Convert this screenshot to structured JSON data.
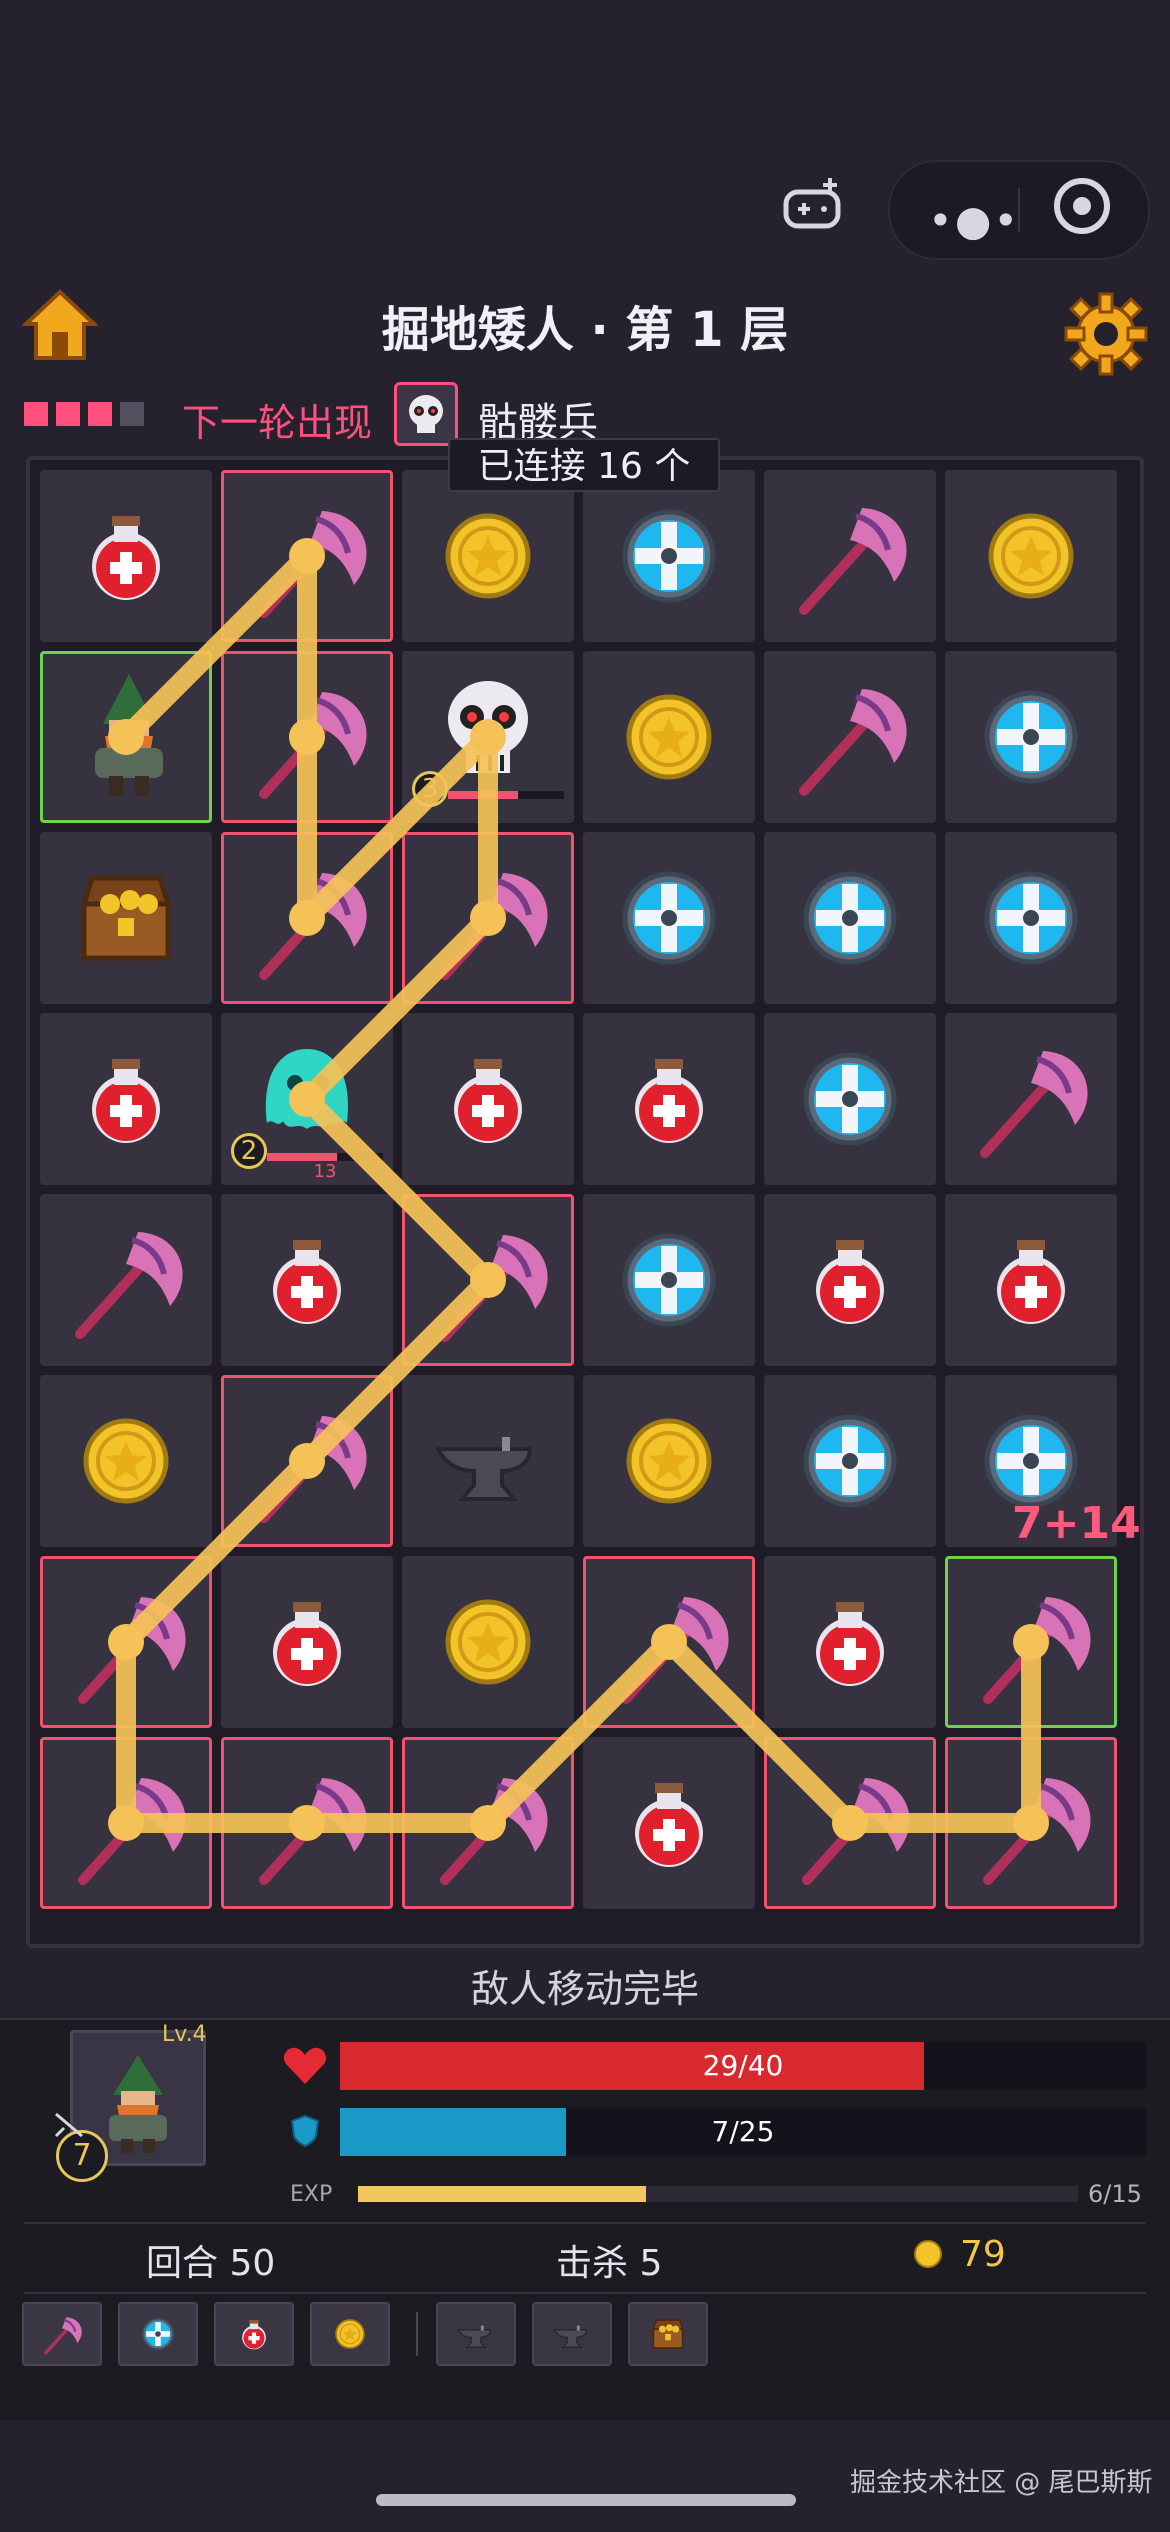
{
  "app": {
    "title": "掘地矮人 · 第 1 层"
  },
  "next_turn": {
    "label": "下一轮出现",
    "enemy_name": "骷髅兵",
    "chain_text": "已连接 16 个",
    "turn_dots": [
      "#ff4f7d",
      "#ff4f7d",
      "#ff4f7d",
      "#555060"
    ]
  },
  "board": {
    "rows": [
      [
        "potion",
        "axe",
        "coin",
        "shield",
        "axe",
        "coin"
      ],
      [
        "hero",
        "axe",
        "skeleton",
        "coin",
        "axe",
        "shield"
      ],
      [
        "chest",
        "axe",
        "axe",
        "shield",
        "shield",
        "shield"
      ],
      [
        "potion",
        "slime",
        "potion",
        "potion",
        "shield",
        "axe"
      ],
      [
        "axe",
        "potion",
        "axe",
        "shield",
        "potion",
        "potion"
      ],
      [
        "coin",
        "axe",
        "anvil",
        "coin",
        "shield",
        "shield"
      ],
      [
        "axe",
        "potion",
        "coin",
        "axe",
        "potion",
        "axe"
      ],
      [
        "axe",
        "axe",
        "axe",
        "potion",
        "axe",
        "axe"
      ]
    ],
    "selected": [
      [
        0,
        1
      ],
      [
        1,
        1
      ],
      [
        2,
        1
      ],
      [
        2,
        2
      ],
      [
        4,
        2
      ],
      [
        5,
        1
      ],
      [
        6,
        0
      ],
      [
        7,
        0
      ],
      [
        7,
        1
      ],
      [
        7,
        2
      ],
      [
        6,
        3
      ],
      [
        7,
        4
      ],
      [
        7,
        5
      ],
      [
        6,
        5
      ]
    ],
    "hero_cells": [
      [
        1,
        0
      ],
      [
        6,
        5
      ]
    ],
    "enemies": [
      {
        "row": 1,
        "col": 2,
        "attack": "3",
        "hp_label": ""
      },
      {
        "row": 3,
        "col": 1,
        "attack": "2",
        "hp_label": "13"
      }
    ],
    "damage_popup": "7+14",
    "path": [
      [
        1,
        0
      ],
      [
        0,
        1
      ],
      [
        1,
        1
      ],
      [
        2,
        1
      ],
      [
        1,
        2
      ],
      [
        2,
        2
      ],
      [
        3,
        1
      ],
      [
        4,
        2
      ],
      [
        5,
        1
      ],
      [
        6,
        0
      ],
      [
        7,
        0
      ],
      [
        7,
        1
      ],
      [
        7,
        2
      ],
      [
        6,
        3
      ],
      [
        7,
        4
      ],
      [
        7,
        5
      ],
      [
        6,
        5
      ]
    ]
  },
  "status": {
    "message": "敌人移动完毕"
  },
  "player": {
    "level": "Lv.4",
    "attack": "7",
    "hp": {
      "current": 29,
      "max": 40,
      "text": "29/40"
    },
    "armor": {
      "current": 7,
      "max": 25,
      "text": "7/25"
    },
    "exp": {
      "label": "EXP",
      "current": 6,
      "max": 15,
      "text": "6/15"
    }
  },
  "counters": {
    "turn_label": "回合 50",
    "kills_label": "击杀 5",
    "gold": "79"
  },
  "tray_items": [
    "axe",
    "shield",
    "potion",
    "coin",
    "anvil-gold",
    "anvil",
    "chest"
  ],
  "watermark": "掘金技术社区 @ 尾巴斯斯",
  "colors": {
    "accent": "#ff4f7d",
    "hp": "#d82a2e",
    "armor": "#1b9ac8",
    "exp": "#f2c85a",
    "path": "#f5c257",
    "hero_border": "#6fd34a"
  }
}
